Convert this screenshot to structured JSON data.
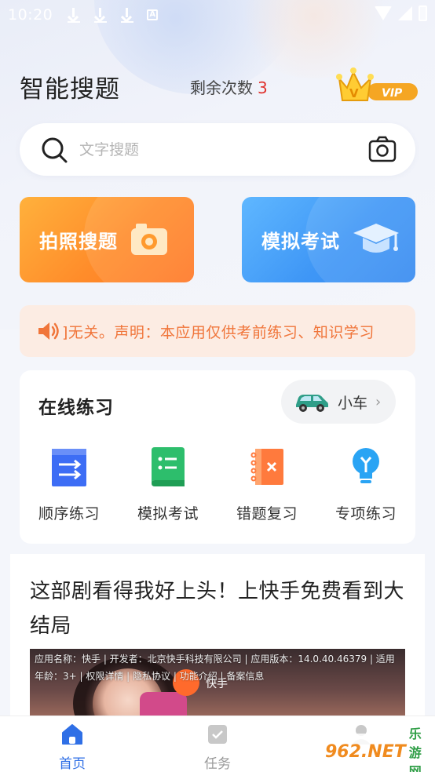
{
  "status_bar": {
    "time": "10:20",
    "icons": [
      "download-icon",
      "download-icon",
      "download-icon",
      "a-box-icon",
      "wifi-icon",
      "signal-icon",
      "battery-icon"
    ]
  },
  "header": {
    "title": "智能搜题",
    "remaining_label": "剩余次数",
    "remaining_count": "3",
    "vip_label": "VIP"
  },
  "search": {
    "placeholder": "文字搜题",
    "icon": "search-icon",
    "camera_icon": "camera-icon"
  },
  "actions": {
    "photo_search": "拍照搜题",
    "mock_exam": "模拟考试"
  },
  "notice": {
    "icon": "speaker-icon",
    "text": "]无关。声明：本应用仅供考前练习、知识学习"
  },
  "practice": {
    "title": "在线练习",
    "car_type": "小车",
    "items": [
      {
        "label": "顺序练习",
        "icon": "sequence-list-icon",
        "color": "#3d6df5"
      },
      {
        "label": "模拟考试",
        "icon": "exam-doc-icon",
        "color": "#2dbe6c"
      },
      {
        "label": "错题复习",
        "icon": "wrong-book-icon",
        "color": "#ff7a3d"
      },
      {
        "label": "专项练习",
        "icon": "lightbulb-icon",
        "color": "#2aa4f4"
      }
    ]
  },
  "ad": {
    "title": "这部剧看得我好上头！上快手免费看到大结局",
    "info": "应用名称：快手 | 开发者：北京快手科技有限公司 | 应用版本：14.0.40.46379 | 适用年龄：3+ | 权限详情 | 隐私协议 | 功能介绍 | 备案信息",
    "brand": "快手"
  },
  "bottom_nav": {
    "items": [
      {
        "label": "首页",
        "icon": "home-icon",
        "active": true
      },
      {
        "label": "任务",
        "icon": "task-icon",
        "active": false
      },
      {
        "label": "",
        "icon": "profile-icon",
        "active": false
      }
    ]
  },
  "watermark": {
    "text1": "962.NET",
    "text2": "乐游网"
  },
  "colors": {
    "accent_blue": "#2f6fe6",
    "orange": "#ff8c2a",
    "red_count": "#e0322e",
    "notice_text": "#f0753a"
  }
}
